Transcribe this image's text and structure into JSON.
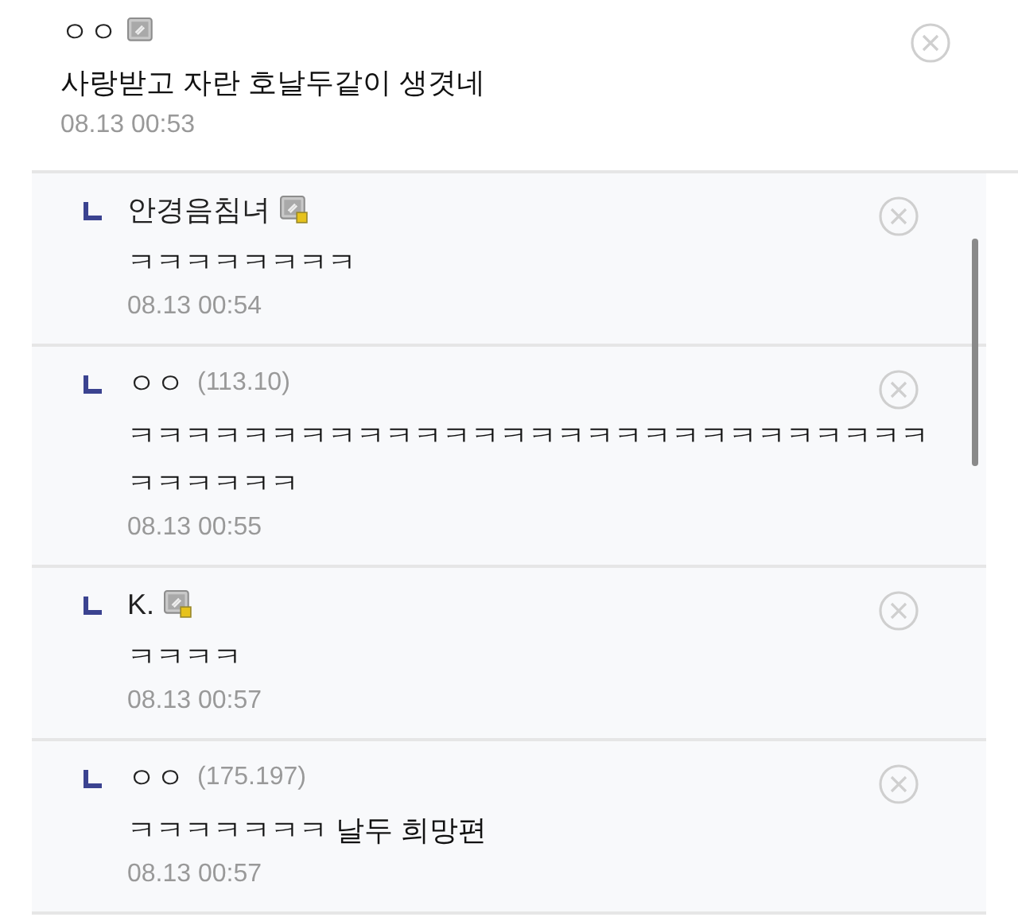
{
  "comment": {
    "author": "ㅇㅇ",
    "kind": "member",
    "text": "사랑받고 자란 호날두같이 생겻네",
    "time": "08.13 00:53"
  },
  "replies": [
    {
      "author": "안경음침녀",
      "kind": "fixed-member",
      "text": "ㅋㅋㅋㅋㅋㅋㅋㅋ",
      "time": "08.13 00:54"
    },
    {
      "author": "ㅇㅇ",
      "kind": "guest",
      "ip": "(113.10)",
      "text": "ㅋㅋㅋㅋㅋㅋㅋㅋㅋㅋㅋㅋㅋㅋㅋㅋㅋㅋㅋㅋㅋㅋㅋㅋㅋㅋㅋㅋㅋㅋㅋㅋㅋㅋ",
      "time": "08.13 00:55"
    },
    {
      "author": "K.",
      "kind": "fixed-member",
      "text": "ㅋㅋㅋㅋ",
      "time": "08.13 00:57"
    },
    {
      "author": "ㅇㅇ",
      "kind": "guest",
      "ip": "(175.197)",
      "text": "ㅋㅋㅋㅋㅋㅋㅋ 날두 희망편",
      "time": "08.13 00:57"
    }
  ]
}
